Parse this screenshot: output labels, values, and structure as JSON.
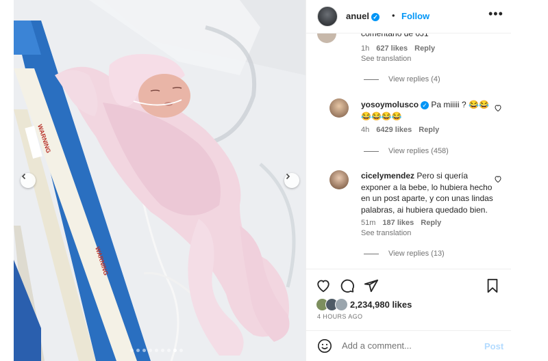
{
  "header": {
    "username": "anuel",
    "separator": "•",
    "follow_label": "Follow"
  },
  "media": {
    "warning_text_1": "WARNING",
    "warning_text_2": "WARNING",
    "carousel_dots": 9,
    "active_dot": 7
  },
  "comments": [
    {
      "partial_text": "comentario de 0J1",
      "time": "1h",
      "likes": "627 likes",
      "reply": "Reply",
      "see_translation": "See translation",
      "view_replies": "View replies (4)"
    },
    {
      "username": "yosoymolusco",
      "text_line1": "Pa miiiii ? 😂😂",
      "text_line2": "😂😂😂😂",
      "time": "4h",
      "likes": "6429 likes",
      "reply": "Reply",
      "view_replies": "View replies (458)"
    },
    {
      "username": "cicelymendez",
      "text_line1": "Pero si quería",
      "text_line2": "exponer a la bebe, lo hubiera hecho",
      "text_line3": "en un post aparte, y con unas lindas",
      "text_line4": "palabras, ai hubiera quedado bien.",
      "time": "51m",
      "likes": "187 likes",
      "reply": "Reply",
      "see_translation": "See translation",
      "view_replies": "View replies (13)"
    }
  ],
  "post": {
    "likes_count": "2,234,980 likes",
    "time_ago": "4 HOURS AGO"
  },
  "add_comment": {
    "placeholder": "Add a comment...",
    "post_label": "Post"
  },
  "colors": {
    "accent": "#0095f6",
    "text": "#262626",
    "muted": "#737373",
    "post_disabled": "#b3dbff"
  }
}
